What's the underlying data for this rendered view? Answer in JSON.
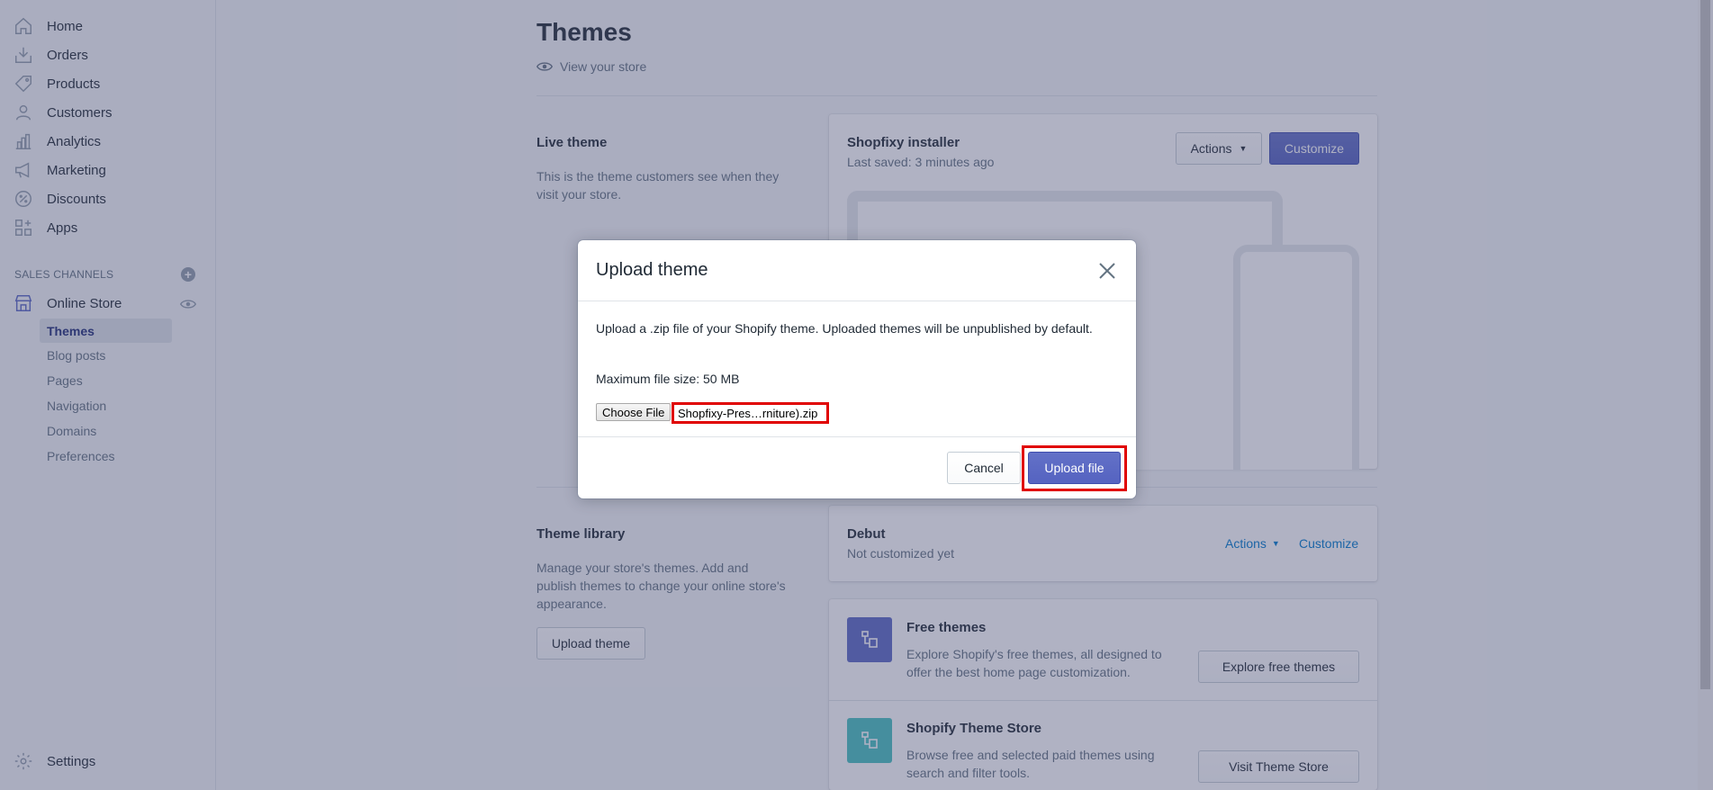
{
  "sidebar": {
    "nav": [
      {
        "label": "Home",
        "icon": "home-icon"
      },
      {
        "label": "Orders",
        "icon": "orders-icon"
      },
      {
        "label": "Products",
        "icon": "tag-icon"
      },
      {
        "label": "Customers",
        "icon": "person-icon"
      },
      {
        "label": "Analytics",
        "icon": "bar-chart-icon"
      },
      {
        "label": "Marketing",
        "icon": "megaphone-icon"
      },
      {
        "label": "Discounts",
        "icon": "discount-icon"
      },
      {
        "label": "Apps",
        "icon": "apps-icon"
      }
    ],
    "sales_channels_heading": "SALES CHANNELS",
    "online_store": "Online Store",
    "sub_items": [
      "Themes",
      "Blog posts",
      "Pages",
      "Navigation",
      "Domains",
      "Preferences"
    ],
    "settings": "Settings"
  },
  "main": {
    "title": "Themes",
    "view_store": "View your store",
    "live_theme": {
      "heading": "Live theme",
      "description": "This is the theme customers see when they visit your store.",
      "card_title": "Shopfixy installer",
      "last_saved": "Last saved: 3 minutes ago",
      "actions_label": "Actions",
      "customize_label": "Customize"
    },
    "theme_library": {
      "heading": "Theme library",
      "description": "Manage your store's themes. Add and publish themes to change your online store's appearance.",
      "upload_button": "Upload theme",
      "debut_title": "Debut",
      "debut_sub": "Not customized yet",
      "actions_label": "Actions",
      "customize_label": "Customize",
      "free_title": "Free themes",
      "free_desc": "Explore Shopify's free themes, all designed to offer the best home page customization.",
      "free_button": "Explore free themes",
      "store_title": "Shopify Theme Store",
      "store_desc": "Browse free and selected paid themes using search and filter tools.",
      "store_button": "Visit Theme Store"
    }
  },
  "modal": {
    "title": "Upload theme",
    "text": "Upload a .zip file of your Shopify theme. Uploaded themes will be unpublished by default.",
    "max_size": "Maximum file size: 50 MB",
    "choose_file": "Choose File",
    "file_name": "Shopfixy-Pres…rniture).zip",
    "cancel": "Cancel",
    "upload": "Upload file"
  },
  "colors": {
    "primary": "#5c6ac4",
    "highlight": "#e00000",
    "free_tile": "#5c6ac4",
    "store_tile": "#47c1bf"
  }
}
